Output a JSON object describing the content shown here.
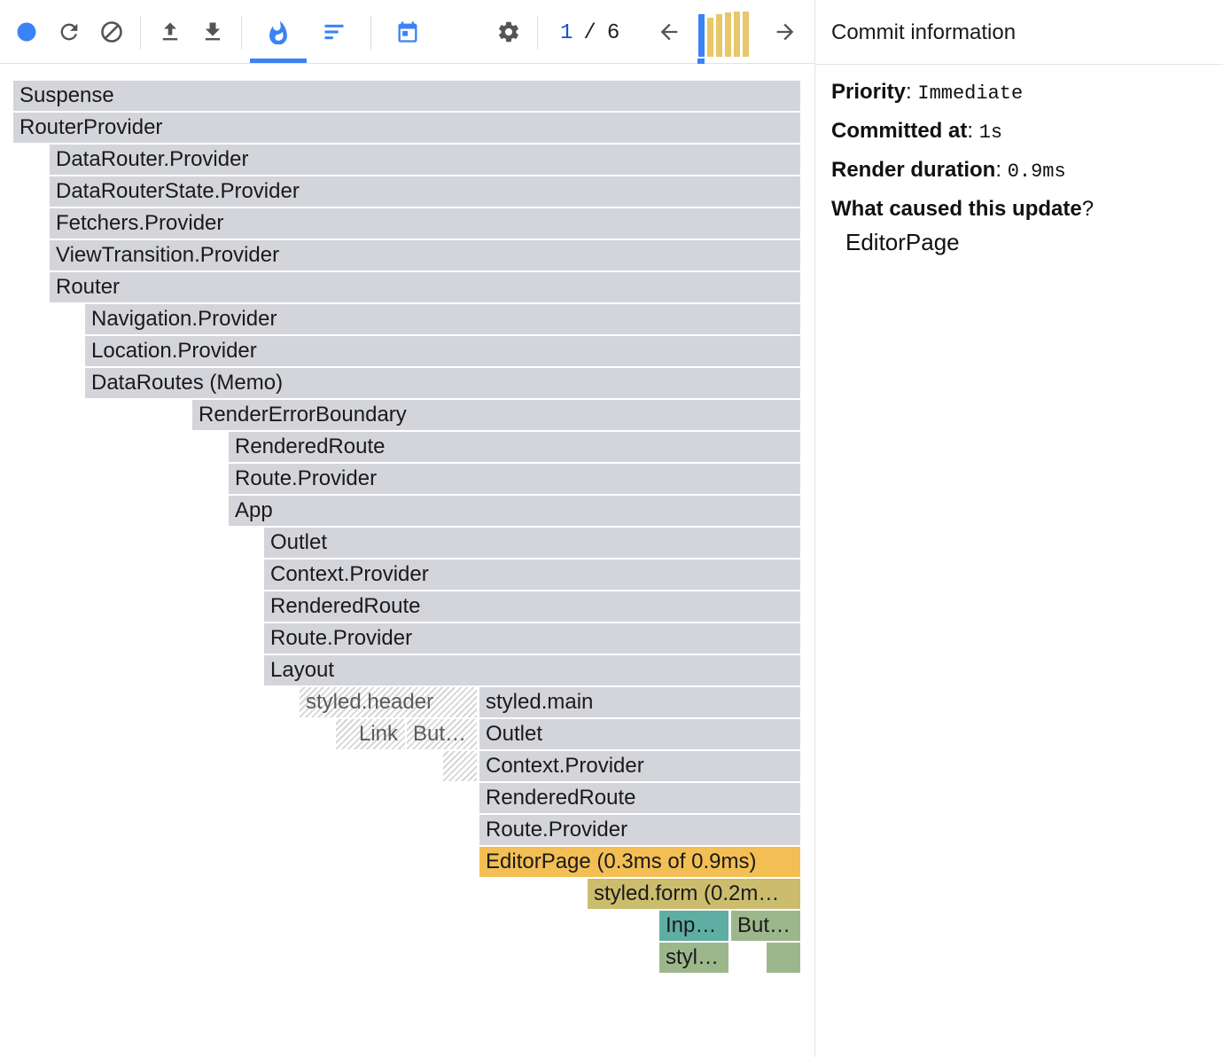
{
  "toolbar": {
    "icons": {
      "record": "record-icon",
      "reload": "reload-icon",
      "clear": "clear-icon",
      "load": "upload-icon",
      "save": "download-icon",
      "flamegraph": "flame-icon",
      "ranked": "ranked-icon",
      "timeline": "calendar-icon",
      "settings": "gear-icon",
      "prev": "arrow-left-icon",
      "next": "arrow-right-icon"
    },
    "colors": {
      "accent": "#3b82f6",
      "icon": "#555555"
    },
    "commit_current": "1",
    "commit_separator": "/",
    "commit_total": "6",
    "commit_bars": [
      0.88,
      0.82,
      0.88,
      0.92,
      0.95,
      0.95
    ]
  },
  "flamegraph": {
    "rows": [
      [
        {
          "label": "Suspense",
          "color": "gray"
        }
      ],
      [
        {
          "label": "RouterProvider",
          "color": "gray"
        }
      ],
      [
        {
          "label": "DataRouter.Provider",
          "color": "gray"
        }
      ],
      [
        {
          "label": "DataRouterState.Provider",
          "color": "gray"
        }
      ],
      [
        {
          "label": "Fetchers.Provider",
          "color": "gray"
        }
      ],
      [
        {
          "label": "ViewTransition.Provider",
          "color": "gray"
        }
      ],
      [
        {
          "label": "Router",
          "color": "gray"
        }
      ],
      [
        {
          "label": "Navigation.Provider",
          "color": "gray"
        }
      ],
      [
        {
          "label": "Location.Provider",
          "color": "gray"
        }
      ],
      [
        {
          "label": "DataRoutes (Memo)",
          "color": "gray"
        }
      ],
      [
        {
          "label": "RenderErrorBoundary",
          "color": "gray"
        }
      ],
      [
        {
          "label": "RenderedRoute",
          "color": "gray"
        }
      ],
      [
        {
          "label": "Route.Provider",
          "color": "gray"
        }
      ],
      [
        {
          "label": "App",
          "color": "gray"
        }
      ],
      [
        {
          "label": "Outlet",
          "color": "gray"
        }
      ],
      [
        {
          "label": "Context.Provider",
          "color": "gray"
        }
      ],
      [
        {
          "label": "RenderedRoute",
          "color": "gray"
        }
      ],
      [
        {
          "label": "Route.Provider",
          "color": "gray"
        }
      ],
      [
        {
          "label": "Layout",
          "color": "gray"
        }
      ],
      [
        {
          "label": "styled.header",
          "color": "hatched"
        },
        {
          "label": "styled.main",
          "color": "gray"
        }
      ],
      [
        {
          "label": "Link",
          "color": "hatched"
        },
        {
          "label": "But…",
          "color": "hatched"
        },
        {
          "label": "Outlet",
          "color": "gray"
        }
      ],
      [
        {
          "label": "",
          "color": "hatched"
        },
        {
          "label": "Context.Provider",
          "color": "gray"
        }
      ],
      [
        {
          "label": "RenderedRoute",
          "color": "gray"
        }
      ],
      [
        {
          "label": "Route.Provider",
          "color": "gray"
        }
      ],
      [
        {
          "label": "EditorPage (0.3ms of 0.9ms)",
          "color": "orange"
        }
      ],
      [
        {
          "label": "styled.form (0.2m…",
          "color": "khaki"
        }
      ],
      [
        {
          "label": "Inp…",
          "color": "teal"
        },
        {
          "label": "But…",
          "color": "sage"
        }
      ],
      [
        {
          "label": "styl…",
          "color": "sage"
        },
        {
          "label": "",
          "color": "sage"
        }
      ]
    ]
  },
  "sidebar": {
    "title": "Commit information",
    "priority_label": "Priority",
    "priority_value": "Immediate",
    "committed_label": "Committed at",
    "committed_value": "1s",
    "duration_label": "Render duration",
    "duration_value": "0.9ms",
    "cause_label": "What caused this update",
    "cause_items": [
      "EditorPage"
    ]
  }
}
